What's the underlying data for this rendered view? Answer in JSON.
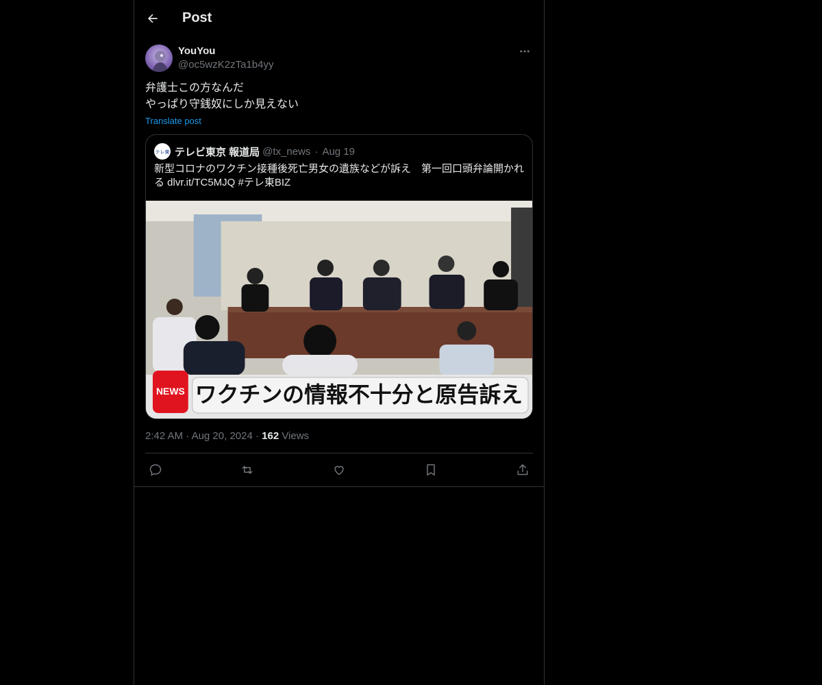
{
  "header": {
    "title": "Post"
  },
  "post": {
    "display_name": "YouYou",
    "handle": "@oc5wzK2zTa1b4yy",
    "text": "弁護士この方なんだ\nやっぱり守銭奴にしか見えない",
    "translate_label": "Translate post",
    "time": "2:42 AM",
    "date": "Aug 20, 2024",
    "views_count": "162",
    "views_label": "Views"
  },
  "quote": {
    "avatar_text": "テレ東",
    "name": "テレビ東京 報道局",
    "handle": "@tx_news",
    "date": "Aug 19",
    "text": "新型コロナのワクチン接種後死亡男女の遺族などが訴え　第一回口頭弁論開かれる dlvr.it/TC5MJQ #テレ東BIZ",
    "media_news": "NEWS",
    "media_caption": "ワクチンの情報不十分と原告訴え"
  },
  "icons": {
    "back": "back-arrow-icon",
    "more": "more-options-icon",
    "reply": "reply-icon",
    "repost": "repost-icon",
    "like": "like-icon",
    "bookmark": "bookmark-icon",
    "share": "share-icon"
  },
  "colors": {
    "link": "#1d9bf0",
    "secondary": "#71767b",
    "border": "#2f3336"
  }
}
